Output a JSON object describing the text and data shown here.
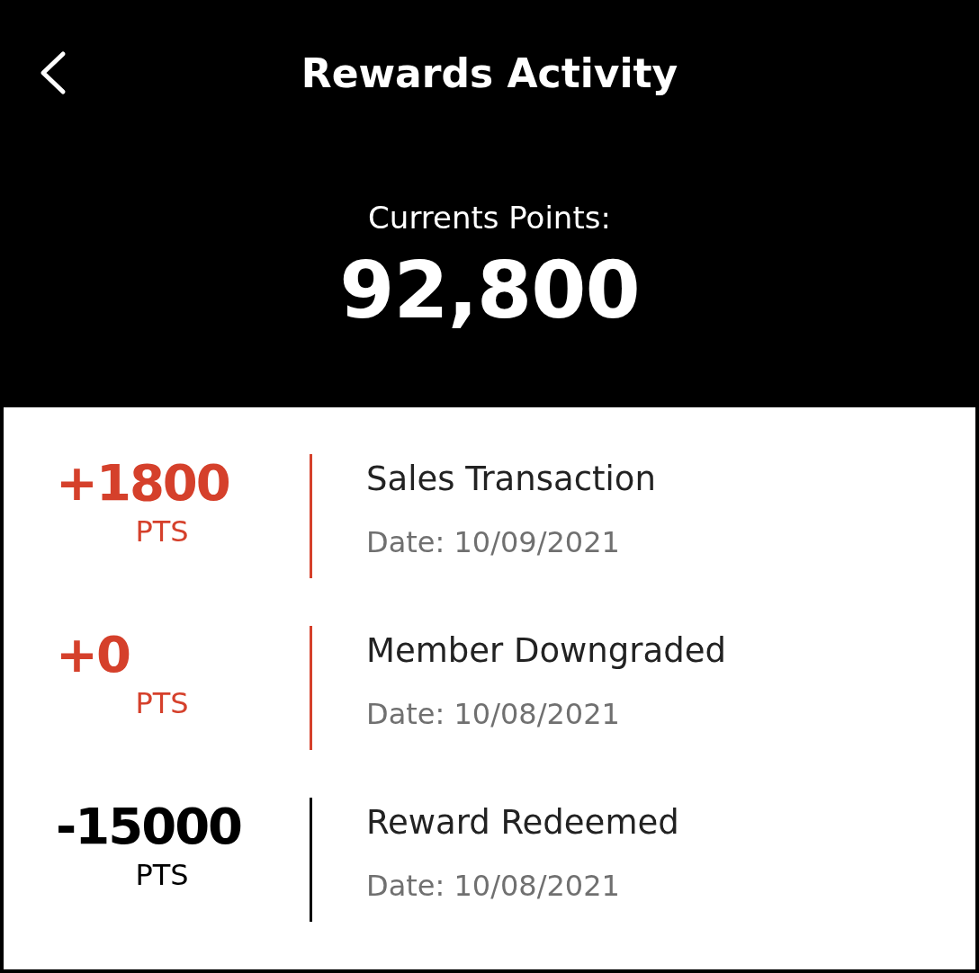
{
  "header": {
    "title": "Rewards Activity",
    "points_label": "Currents Points:",
    "points_value": "92,800"
  },
  "activities": [
    {
      "amount": "+1800",
      "unit": "PTS",
      "color": "#d5402b",
      "title": "Sales Transaction",
      "date": "Date: 10/09/2021"
    },
    {
      "amount": "+0",
      "unit": "PTS",
      "color": "#d5402b",
      "title": "Member Downgraded",
      "date": "Date: 10/08/2021"
    },
    {
      "amount": "-15000",
      "unit": "PTS",
      "color": "#000000",
      "title": "Reward Redeemed",
      "date": "Date: 10/08/2021"
    }
  ]
}
